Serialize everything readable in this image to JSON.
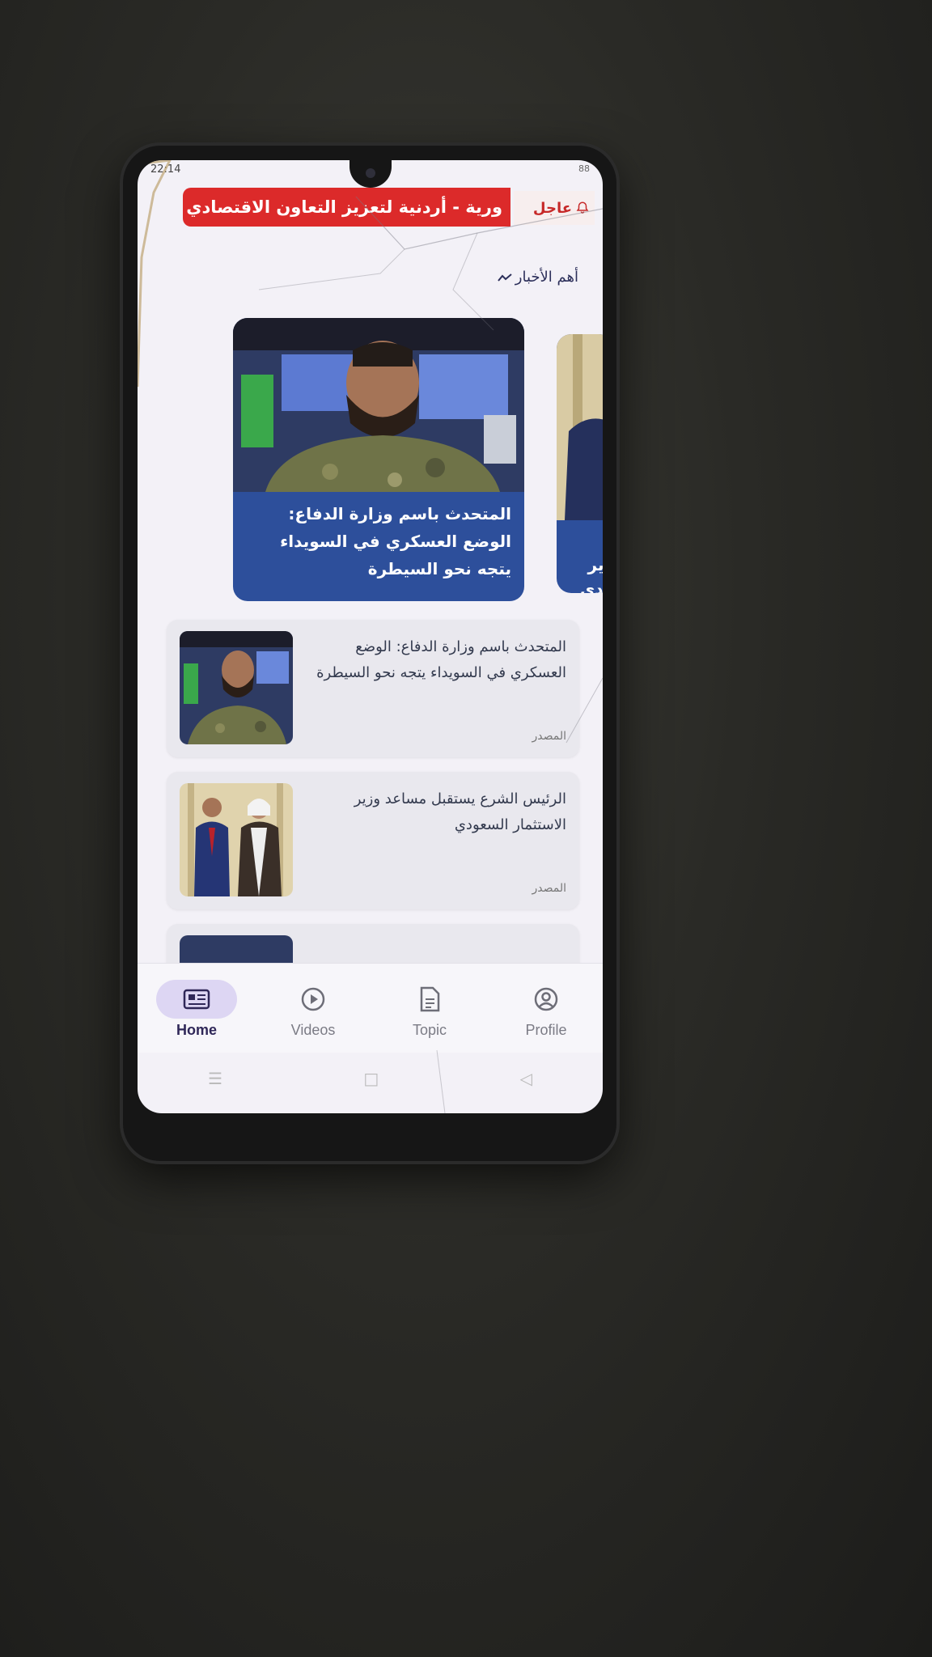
{
  "status_bar": {
    "time": "22:14",
    "signal": "ıl ıl",
    "battery": "88"
  },
  "ticker": {
    "label": "عاجل",
    "headline": "ورية - أردنية لتعزيز التعاون الاقتصادي وال"
  },
  "section": {
    "title": "أهم الأخبار"
  },
  "featured": [
    {
      "title": "المتحدث باسم وزارة الدفاع: الوضع العسكري في السويداء يتجه نحو السيطرة"
    },
    {
      "title": "زير ودي"
    }
  ],
  "news_list": [
    {
      "title": "المتحدث باسم وزارة الدفاع: الوضع العسكري في السويداء يتجه نحو السيطرة",
      "source": "المصدر"
    },
    {
      "title": "الرئيس الشرع يستقبل مساعد وزير الاستثمار السعودي",
      "source": "المصدر"
    }
  ],
  "bottom_nav": [
    {
      "label": "Home",
      "icon": "newspaper-icon",
      "active": true
    },
    {
      "label": "Videos",
      "icon": "play-circle-icon",
      "active": false
    },
    {
      "label": "Topic",
      "icon": "document-icon",
      "active": false
    },
    {
      "label": "Profile",
      "icon": "account-circle-icon",
      "active": false
    }
  ],
  "colors": {
    "ticker_red": "#dc2a2a",
    "card_blue": "#2d4f9b",
    "nav_active": "#ddd6f3"
  }
}
